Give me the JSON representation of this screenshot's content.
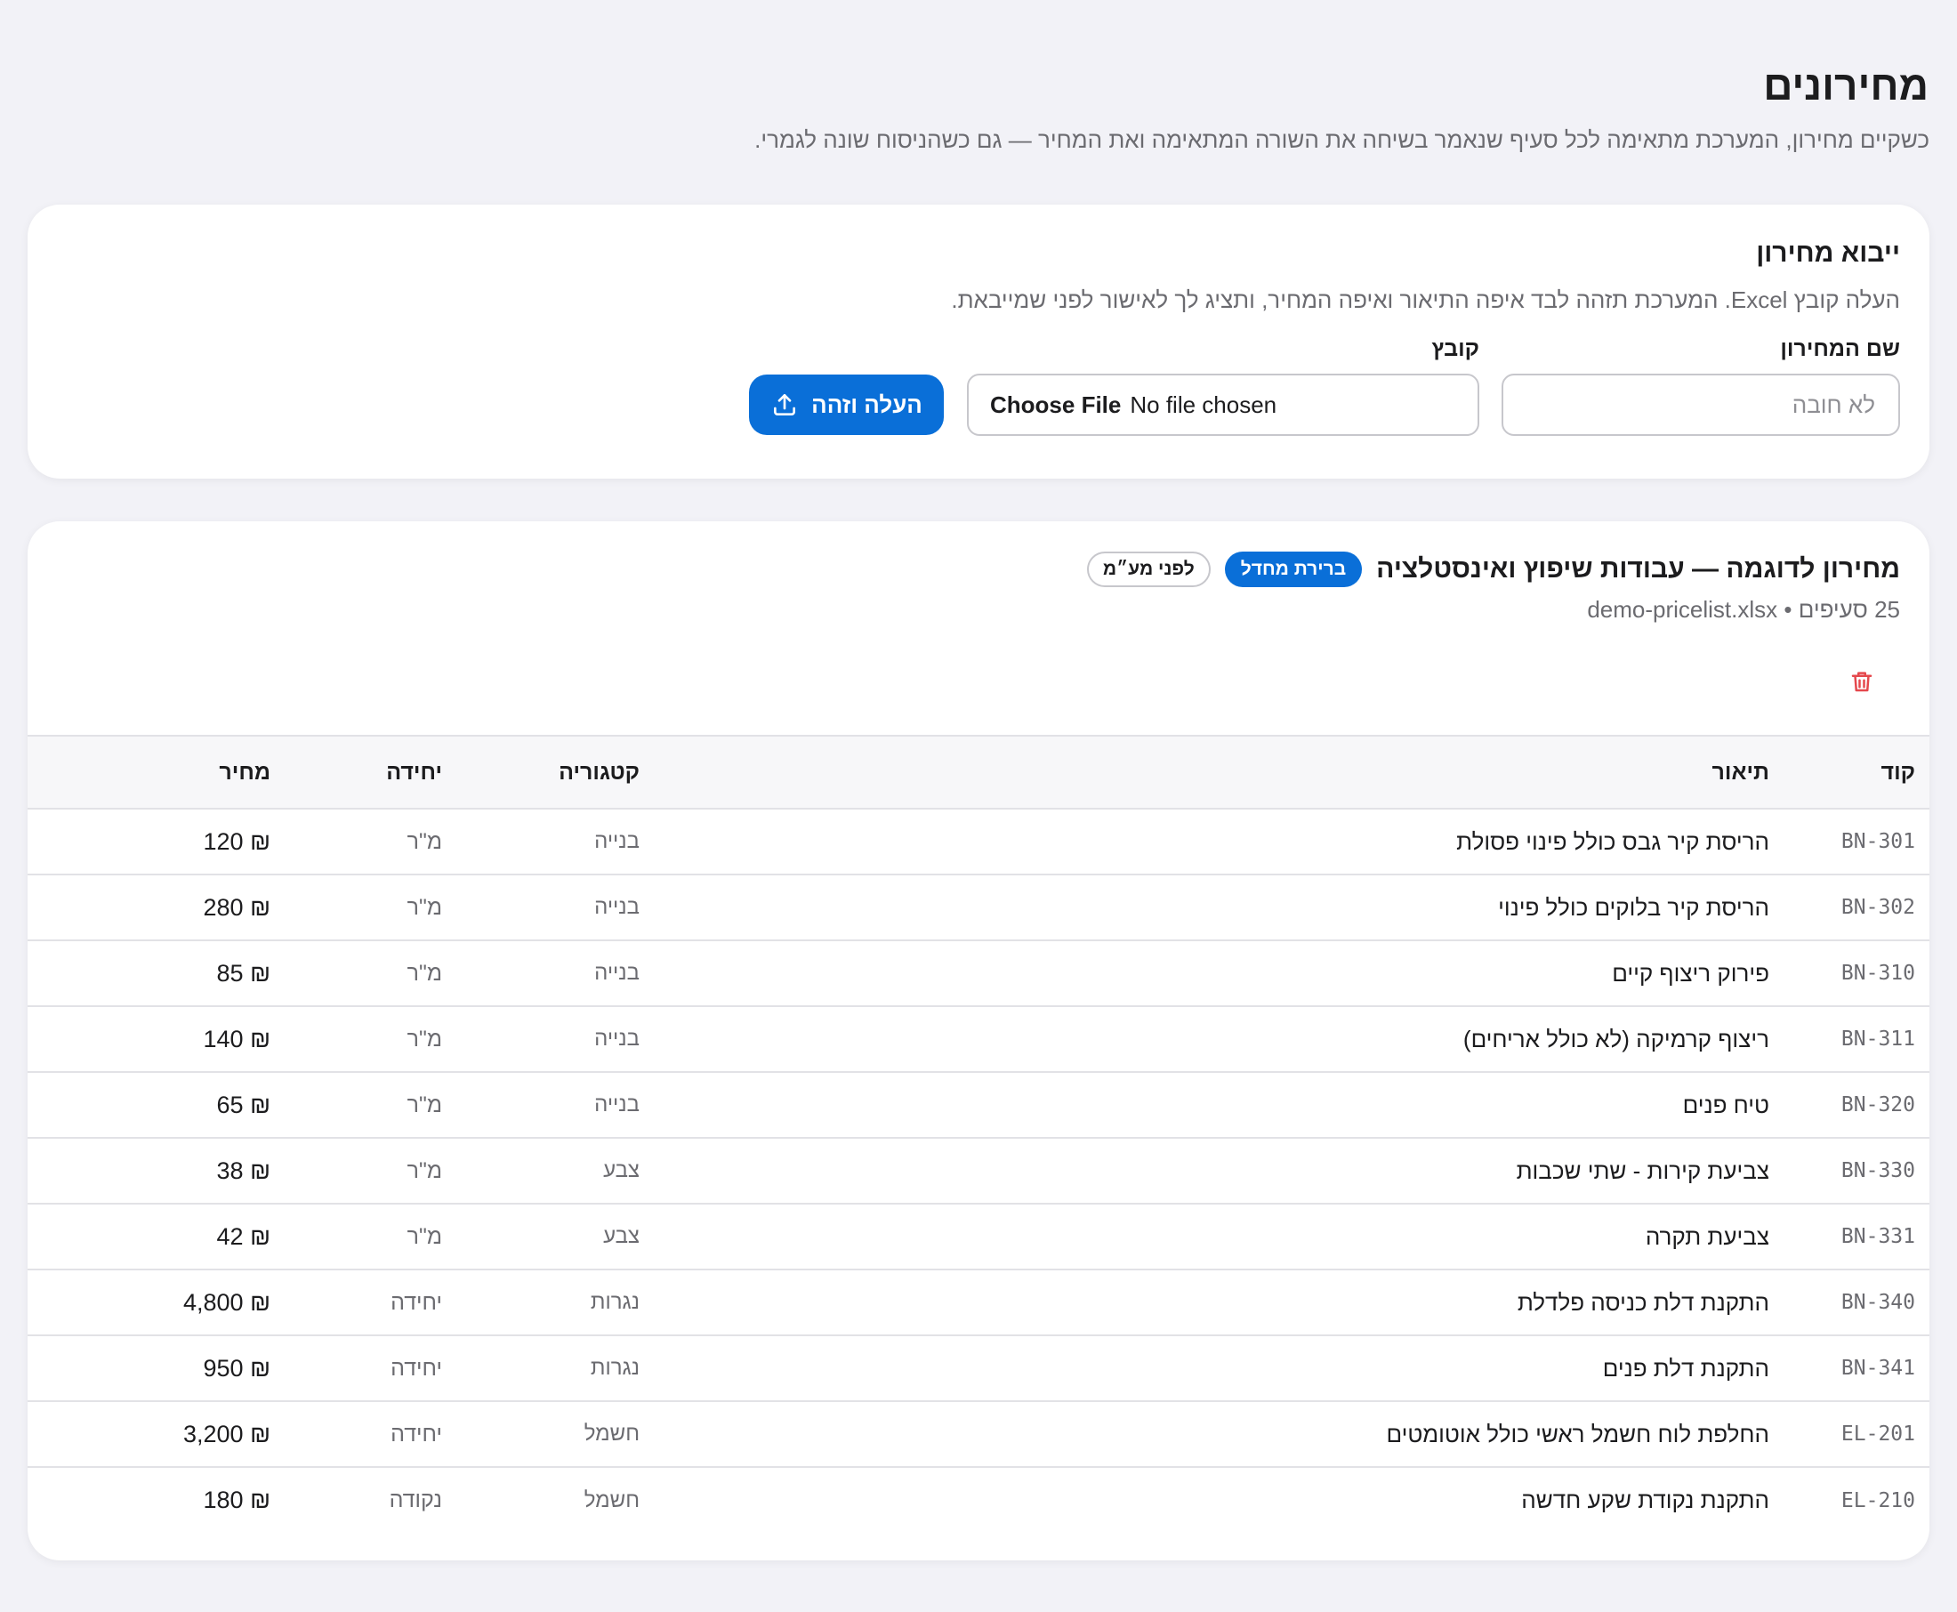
{
  "header": {
    "title": "מחירונים",
    "subtitle": "כשקיים מחירון, המערכת מתאימה לכל סעיף שנאמר בשיחה את השורה המתאימה ואת המחיר — גם כשהניסוח שונה לגמרי."
  },
  "import_section": {
    "title": "ייבוא מחירון",
    "description": "העלה קובץ Excel. המערכת תזהה לבד איפה התיאור ואיפה המחיר, ותציג לך לאישור לפני שמייבאת.",
    "name_label": "שם המחירון",
    "name_placeholder": "לא חובה",
    "name_value": "",
    "file_label": "קובץ",
    "file_button": "Choose File",
    "file_status": "No file chosen",
    "upload_button": "העלה וזהה",
    "upload_icon": "upload-icon"
  },
  "pricelist": {
    "title": "מחירון לדוגמה — עבודות שיפוץ ואינסטלציה",
    "default_badge": "ברירת מחדל",
    "vat_badge": "לפני מע״מ",
    "meta": "25 סעיפים • demo-pricelist.xlsx",
    "delete_icon": "trash-icon",
    "delete_color": "#e5484d",
    "columns": {
      "code": "קוד",
      "description": "תיאור",
      "category": "קטגוריה",
      "unit": "יחידה",
      "price": "מחיר"
    },
    "rows": [
      {
        "code": "BN-301",
        "description": "הריסת קיר גבס כולל פינוי פסולת",
        "category": "בנייה",
        "unit": "מ\"ר",
        "price": "₪ 120"
      },
      {
        "code": "BN-302",
        "description": "הריסת קיר בלוקים כולל פינוי",
        "category": "בנייה",
        "unit": "מ\"ר",
        "price": "₪ 280"
      },
      {
        "code": "BN-310",
        "description": "פירוק ריצוף קיים",
        "category": "בנייה",
        "unit": "מ\"ר",
        "price": "₪ 85"
      },
      {
        "code": "BN-311",
        "description": "ריצוף קרמיקה (לא כולל אריחים)",
        "category": "בנייה",
        "unit": "מ\"ר",
        "price": "₪ 140"
      },
      {
        "code": "BN-320",
        "description": "טיח פנים",
        "category": "בנייה",
        "unit": "מ\"ר",
        "price": "₪ 65"
      },
      {
        "code": "BN-330",
        "description": "צביעת קירות - שתי שכבות",
        "category": "צבע",
        "unit": "מ\"ר",
        "price": "₪ 38"
      },
      {
        "code": "BN-331",
        "description": "צביעת תקרה",
        "category": "צבע",
        "unit": "מ\"ר",
        "price": "₪ 42"
      },
      {
        "code": "BN-340",
        "description": "התקנת דלת כניסה פלדלת",
        "category": "נגרות",
        "unit": "יחידה",
        "price": "₪ 4,800"
      },
      {
        "code": "BN-341",
        "description": "התקנת דלת פנים",
        "category": "נגרות",
        "unit": "יחידה",
        "price": "₪ 950"
      },
      {
        "code": "EL-201",
        "description": "החלפת לוח חשמל ראשי כולל אוטומטים",
        "category": "חשמל",
        "unit": "יחידה",
        "price": "₪ 3,200"
      },
      {
        "code": "EL-210",
        "description": "התקנת נקודת שקע חדשה",
        "category": "חשמל",
        "unit": "נקודה",
        "price": "₪ 180"
      }
    ]
  },
  "colors": {
    "accent": "#0a6fd8",
    "background": "#f2f2f7",
    "danger": "#e5484d"
  }
}
